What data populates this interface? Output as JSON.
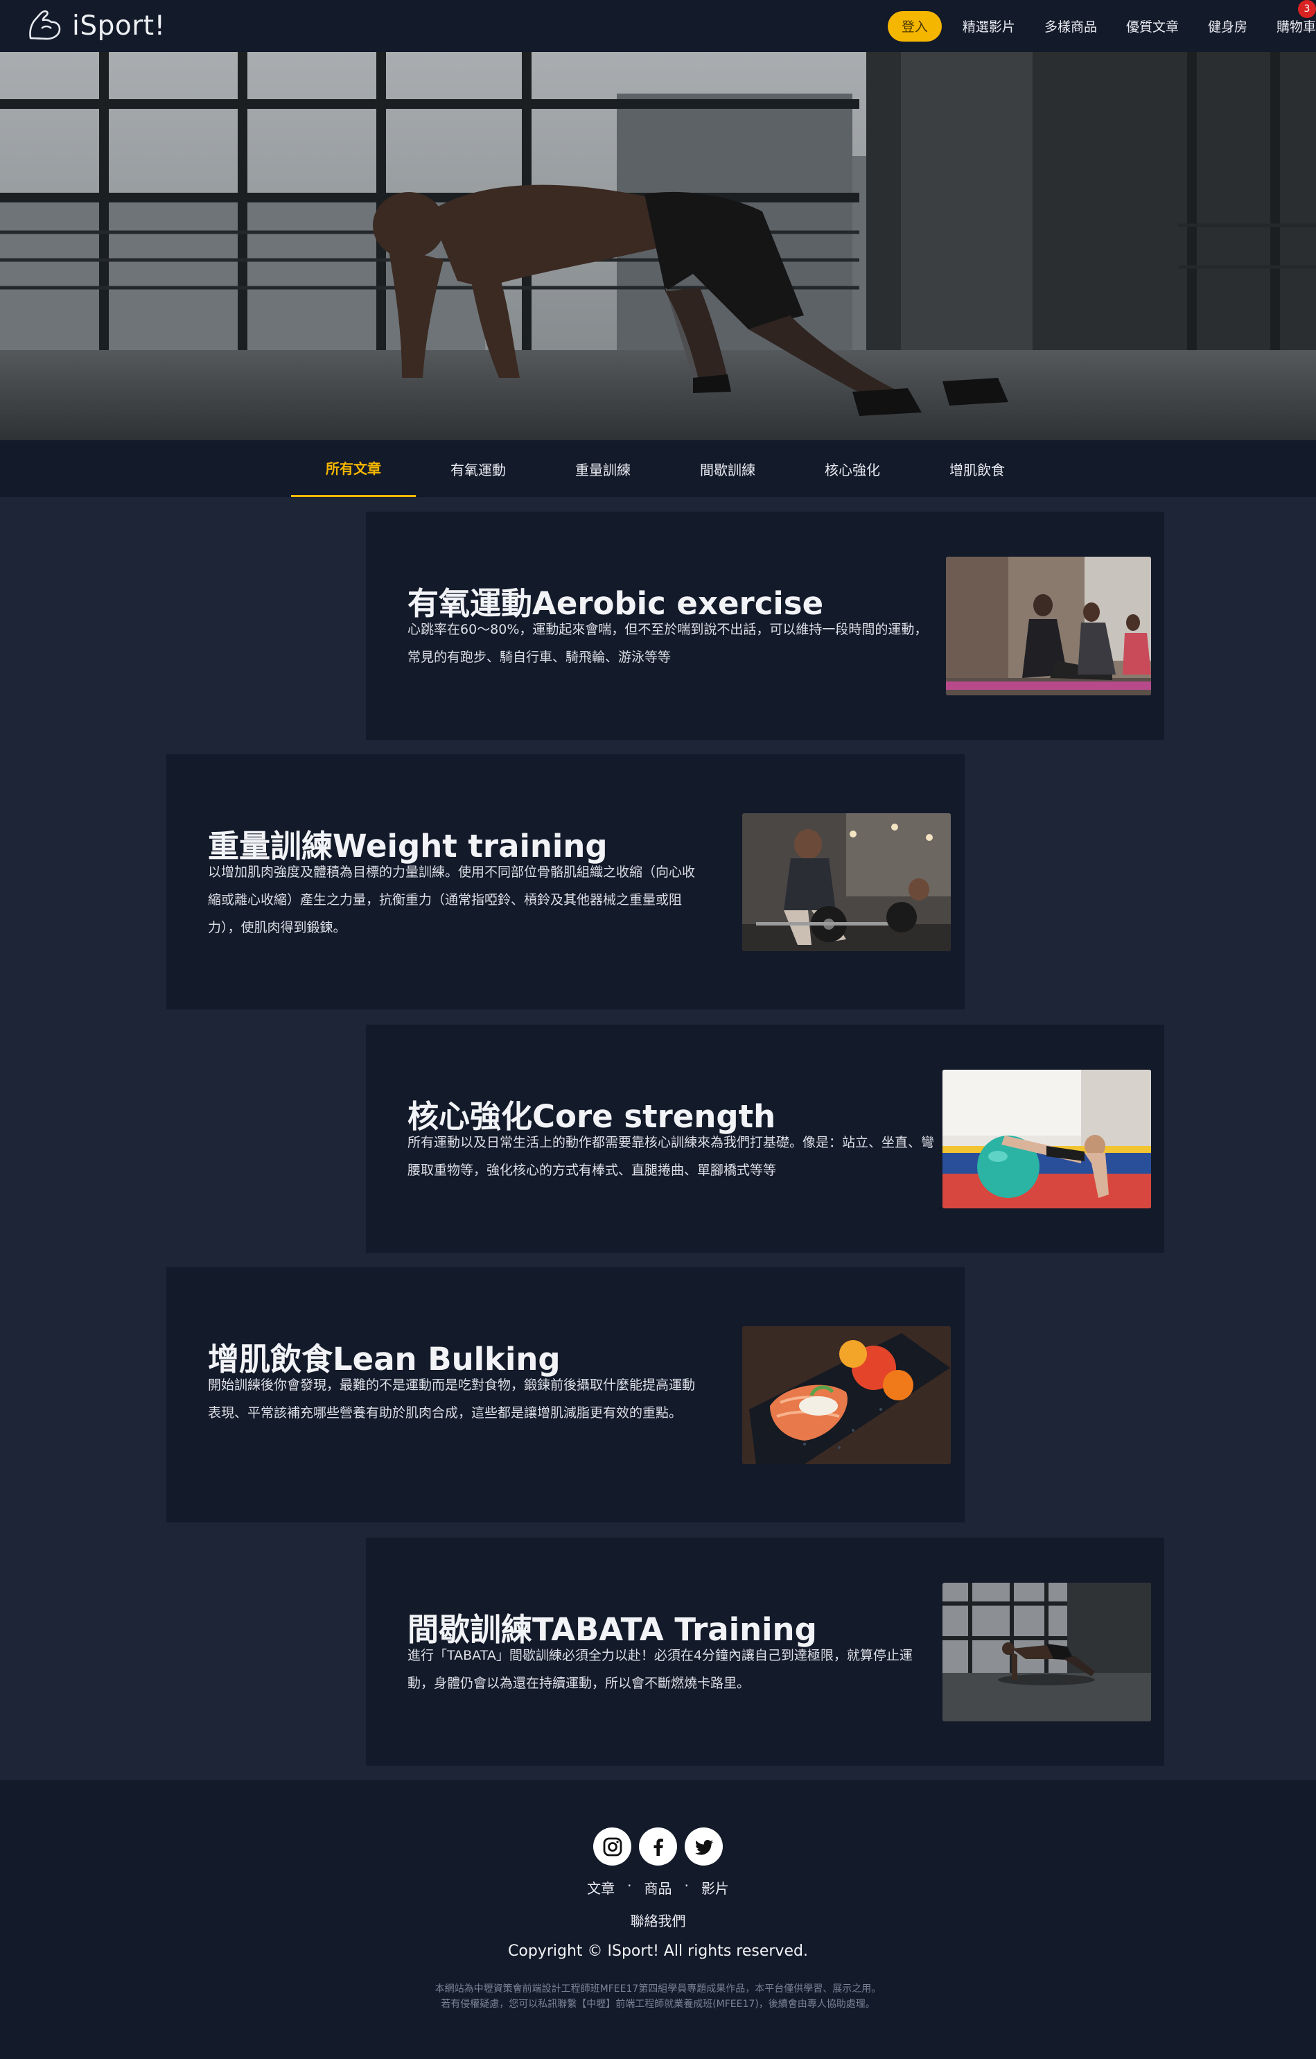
{
  "brand": {
    "name": "iSport!"
  },
  "nav": {
    "login": "登入",
    "links": [
      "精選影片",
      "多樣商品",
      "優質文章",
      "健身房",
      "購物車"
    ],
    "cart_count": "3"
  },
  "tabs": [
    "所有文章",
    "有氧運動",
    "重量訓練",
    "間歇訓練",
    "核心強化",
    "增肌飲食"
  ],
  "articles": [
    {
      "title": "有氧運動Aerobic exercise",
      "desc": "心跳率在60～80%，運動起來會喘，但不至於喘到說不出話，可以維持一段時間的運動，常見的有跑步、騎自行車、騎飛輪、游泳等等",
      "image": "yoga-class-photo"
    },
    {
      "title": "重量訓練Weight training",
      "desc": "以增加肌肉強度及體積為目標的力量訓練。使用不同部位骨骼肌組織之收縮（向心收縮或離心收縮）產生之力量，抗衡重力（通常指啞鈴、槓鈴及其他器械之重量或阻力），使肌肉得到鍛鍊。",
      "image": "deadlift-photo"
    },
    {
      "title": "核心強化Core strength",
      "desc": "所有運動以及日常生活上的動作都需要靠核心訓練來為我們打基礎。像是：站立、坐直、彎腰取重物等，強化核心的方式有棒式、直腿捲曲、單腳橋式等等",
      "image": "stability-ball-photo"
    },
    {
      "title": "增肌飲食Lean Bulking",
      "desc": "開始訓練後你會發現，最難的不是運動而是吃對食物，鍛鍊前後攝取什麼能提高運動表現、平常該補充哪些營養有助於肌肉合成，這些都是讓增肌減脂更有效的重點。",
      "image": "salmon-meal-photo"
    },
    {
      "title": "間歇訓練TABATA Training",
      "desc": "進行「TABATA」間歇訓練必須全力以赴！必須在4分鐘內讓自己到達極限，就算停止運動，身體仍會以為還在持續運動，所以會不斷燃燒卡路里。",
      "image": "mountain-climber-photo"
    }
  ],
  "footer": {
    "social": [
      "instagram-icon",
      "facebook-icon",
      "twitter-icon"
    ],
    "links": [
      "文章",
      "·",
      "商品",
      "·",
      "影片"
    ],
    "contact": "聯絡我們",
    "copyright": "Copyright © ISport! All rights reserved.",
    "disclaimer_1": "本網站為中壢資策會前端設計工程師班MFEE17第四組學員專題成果作品，本平台僅供學習、展示之用。",
    "disclaimer_2": "若有侵權疑慮，您可以私訊聯繫【中壢】前端工程師就業養成班(MFEE17)，後續會由專人協助處理。"
  },
  "colors": {
    "accent": "#f5b600",
    "navbar": "#131a2a",
    "page_bg": "#1d2536",
    "badge": "#d92222"
  }
}
